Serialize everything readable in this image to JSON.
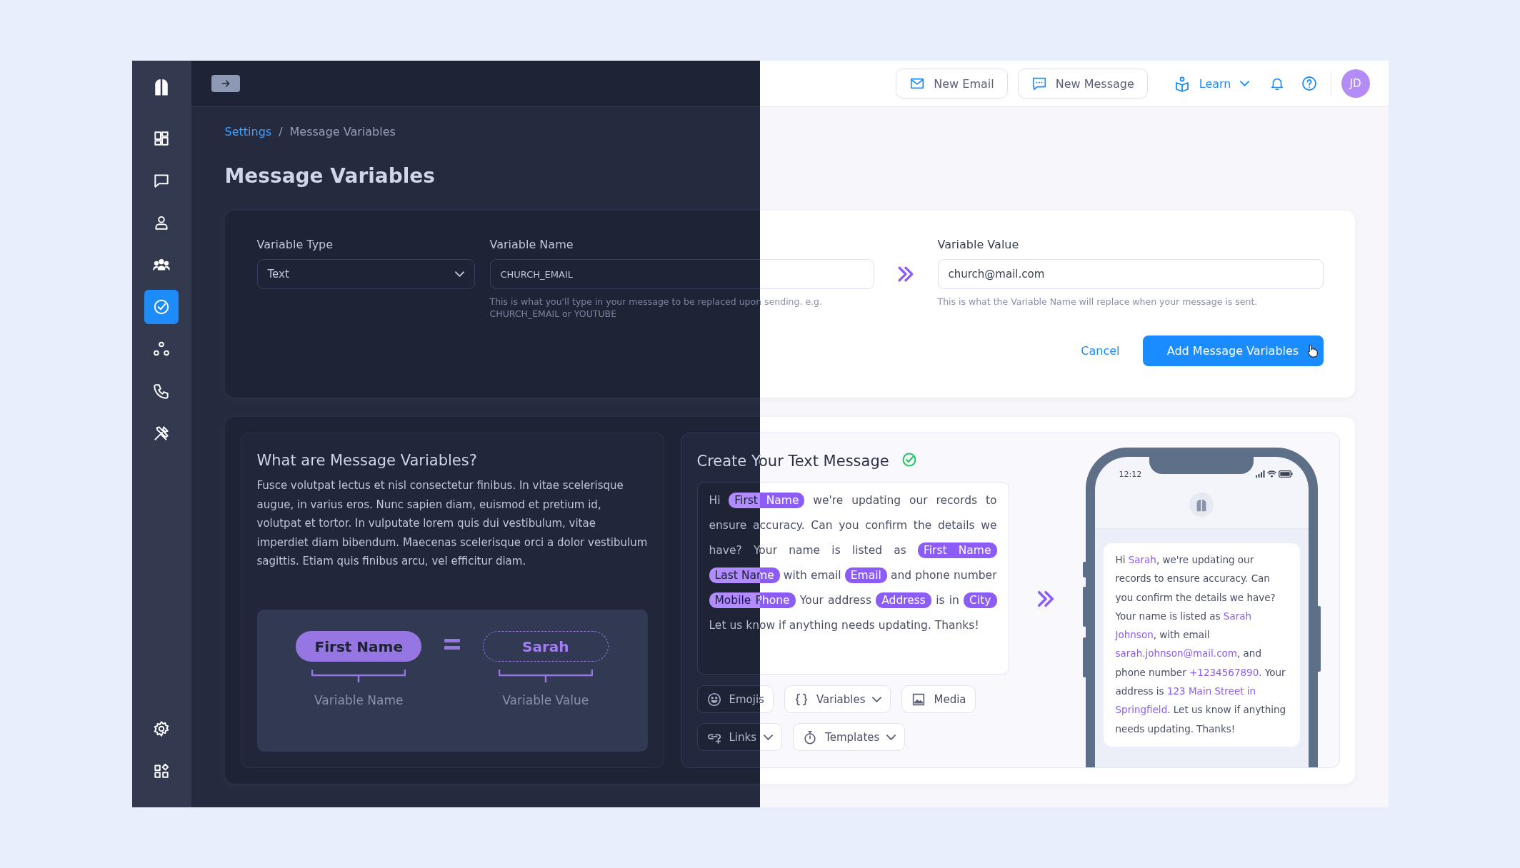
{
  "sidebar": {
    "items": [
      {
        "selected": false
      },
      {
        "selected": false
      },
      {
        "selected": false
      },
      {
        "selected": false
      },
      {
        "selected": true
      },
      {
        "selected": false
      },
      {
        "selected": false
      },
      {
        "selected": false
      }
    ],
    "bottom_items": [
      {
        "selected": false
      },
      {
        "selected": false
      }
    ]
  },
  "topbar": {
    "buttons": [
      {
        "label": "New Email"
      },
      {
        "label": "New Message"
      }
    ],
    "learn": "Learn",
    "avatar": "JD"
  },
  "breadcrumb": {
    "separator": "/",
    "items": [
      {
        "label": "Settings",
        "link": true
      },
      {
        "label": "Message Variables",
        "link": false
      }
    ]
  },
  "title": "Message Variables",
  "form": {
    "variable_type": {
      "label": "Variable Type",
      "value": "Text"
    },
    "variable_name": {
      "label": "Variable Name",
      "value": "CHURCH_EMAIL",
      "hint": "This is what you'll type in your message to be replaced upon sending. e.g. CHURCH_EMAIL or YOUTUBE"
    },
    "variable_value": {
      "label": "Variable Value",
      "value": "church@mail.com",
      "hint": "This is what the Variable Name will replace when your message is sent."
    },
    "cancel": "Cancel",
    "submit": "Add Message Variables"
  },
  "explainer": {
    "heading": "What are Message Variables?",
    "body": "Fusce volutpat lectus et nisl consectetur finibus. In vitae scelerisque augue, in varius eros. Nunc sapien diam, euismod et pretium id, volutpat et tortor. In vulputate lorem quis dui vestibulum, vitae imperdiet diam bibendum. Maecenas scelerisque orci a dolor vestibulum sagittis. Etiam quis finibus arcu, vel efficitur diam.",
    "diagram": {
      "name_chip": "First Name",
      "value_chip": "Sarah",
      "name_caption": "Variable Name",
      "value_caption": "Variable Value"
    }
  },
  "composer": {
    "heading": "Create Your Text Message",
    "message": [
      {
        "kind": "text",
        "text": "Hi"
      },
      {
        "kind": "variable",
        "text": "First Name"
      },
      {
        "kind": "text",
        "text": "we're updating our records to ensure accuracy. Can you confirm the details we have? Your name is listed as"
      },
      {
        "kind": "variable",
        "text": "First Name"
      },
      {
        "kind": "variable",
        "text": "Last Name"
      },
      {
        "kind": "text",
        "text": "with email"
      },
      {
        "kind": "variable",
        "text": "Email"
      },
      {
        "kind": "text",
        "text": "and phone number"
      },
      {
        "kind": "variable",
        "text": "Mobile Phone"
      },
      {
        "kind": "text",
        "text": "Your address"
      },
      {
        "kind": "variable",
        "text": "Address"
      },
      {
        "kind": "text",
        "text": "is in"
      },
      {
        "kind": "variable",
        "text": "City"
      },
      {
        "kind": "text",
        "text": "Let us know if anything needs updating. Thanks!"
      }
    ],
    "tools": [
      {
        "label": "Emojis",
        "menu": false
      },
      {
        "label": "Variables",
        "menu": true
      },
      {
        "label": "Media",
        "menu": false
      },
      {
        "label": "Links",
        "menu": true
      },
      {
        "label": "Templates",
        "menu": true
      }
    ]
  },
  "phone": {
    "time": "12:12",
    "message": [
      {
        "kind": "text",
        "text": "Hi "
      },
      {
        "kind": "value",
        "text": "Sarah"
      },
      {
        "kind": "text",
        "text": ", we're updating our records to ensure accuracy. Can you confirm the details we have? Your name is listed as "
      },
      {
        "kind": "value",
        "text": "Sarah Johnson"
      },
      {
        "kind": "text",
        "text": ", with email "
      },
      {
        "kind": "value",
        "text": "sarah.johnson@mail.com"
      },
      {
        "kind": "text",
        "text": ", and phone number "
      },
      {
        "kind": "value",
        "text": "+1234567890"
      },
      {
        "kind": "text",
        "text": ". Your address is "
      },
      {
        "kind": "value",
        "text": "123 Main Street in Springfield"
      },
      {
        "kind": "text",
        "text": ". Let us know if anything needs updating. Thanks!"
      }
    ]
  }
}
